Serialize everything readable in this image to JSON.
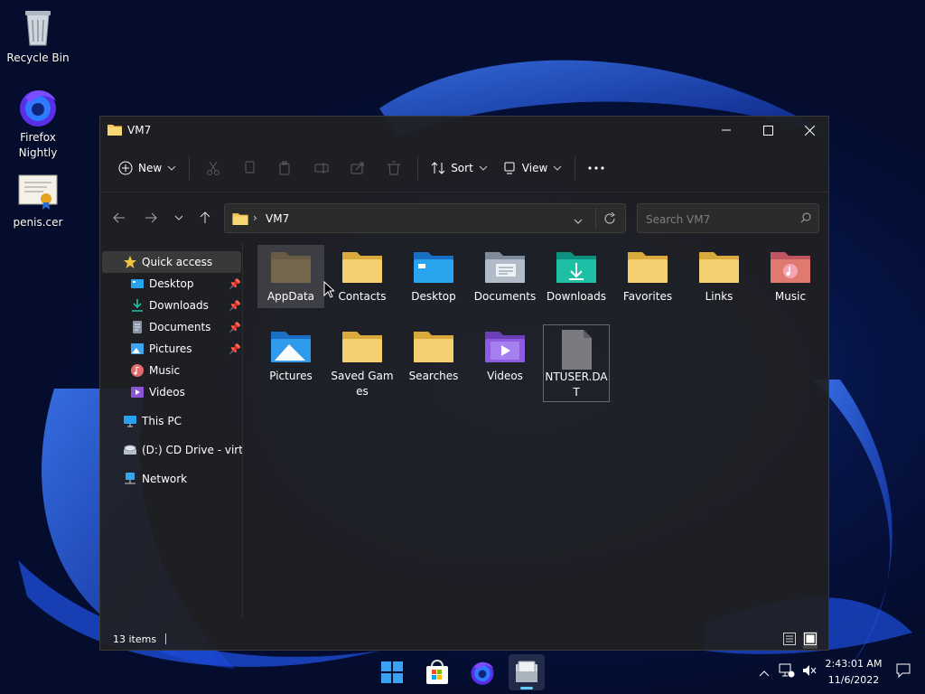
{
  "desktop": {
    "icons": [
      {
        "label": "Recycle Bin"
      },
      {
        "label": "Firefox Nightly"
      },
      {
        "label": "penis.cer"
      }
    ]
  },
  "window": {
    "title": "VM7",
    "toolbar": {
      "new_label": "New",
      "sort_label": "Sort",
      "view_label": "View"
    },
    "address": {
      "path_item": "VM7"
    },
    "search": {
      "placeholder": "Search VM7"
    },
    "sidebar": {
      "quick_access": "Quick access",
      "items": [
        {
          "label": "Desktop",
          "pinned": true
        },
        {
          "label": "Downloads",
          "pinned": true
        },
        {
          "label": "Documents",
          "pinned": true
        },
        {
          "label": "Pictures",
          "pinned": true
        },
        {
          "label": "Music",
          "pinned": false
        },
        {
          "label": "Videos",
          "pinned": false
        }
      ],
      "this_pc": "This PC",
      "cd_drive": "(D:) CD Drive - virtio-win",
      "network": "Network"
    },
    "files": [
      {
        "name": "AppData",
        "icon": "folder-hidden"
      },
      {
        "name": "Contacts",
        "icon": "folder"
      },
      {
        "name": "Desktop",
        "icon": "folder-desktop"
      },
      {
        "name": "Documents",
        "icon": "folder-documents"
      },
      {
        "name": "Downloads",
        "icon": "folder-downloads"
      },
      {
        "name": "Favorites",
        "icon": "folder"
      },
      {
        "name": "Links",
        "icon": "folder"
      },
      {
        "name": "Music",
        "icon": "folder-music"
      },
      {
        "name": "Pictures",
        "icon": "folder-pictures"
      },
      {
        "name": "Saved Games",
        "icon": "folder"
      },
      {
        "name": "Searches",
        "icon": "folder"
      },
      {
        "name": "Videos",
        "icon": "folder-videos"
      },
      {
        "name": "NTUSER.DAT",
        "icon": "file"
      }
    ],
    "status": {
      "item_count": "13 items"
    }
  },
  "taskbar": {
    "time": "2:43:01 AM",
    "date": "11/6/2022"
  },
  "colors": {
    "folder_yellow": "#f3c55a",
    "folder_blue": "#1f9ae6",
    "accent": "#60cdff"
  }
}
